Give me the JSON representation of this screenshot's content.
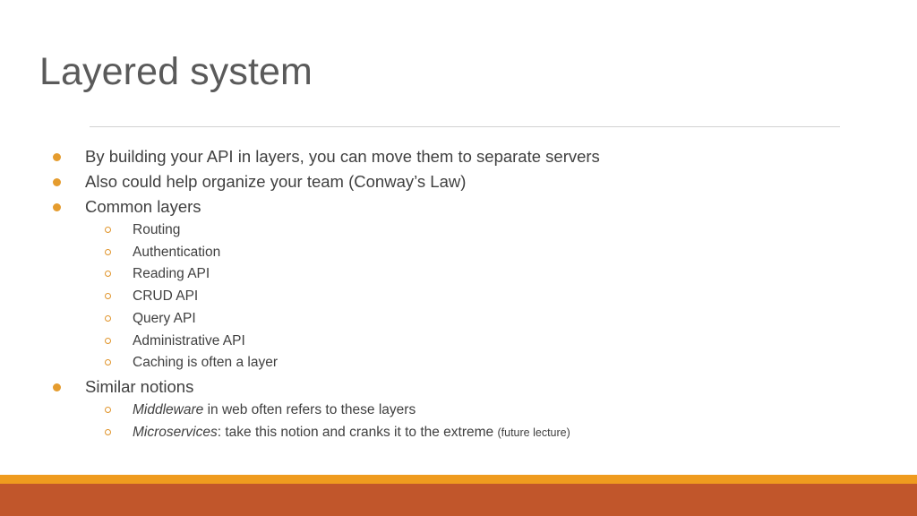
{
  "slide": {
    "title": "Layered system",
    "colors": {
      "title_text": "#5a5a5a",
      "body_text": "#404040",
      "bullet_level1": "#e59c2e",
      "bullet_level2": "#e0942a",
      "divider": "#d2d2d2",
      "footer_strip": "#ef9b1e",
      "footer_band": "#c1562b",
      "background": "#ffffff"
    },
    "bullets": [
      {
        "text": "By building your API in layers, you can move them to separate servers",
        "children": []
      },
      {
        "text": "Also could help organize your team (Conway’s Law)",
        "children": []
      },
      {
        "text": "Common layers",
        "children": [
          {
            "text": "Routing"
          },
          {
            "text": "Authentication"
          },
          {
            "text": "Reading API"
          },
          {
            "text": "CRUD API"
          },
          {
            "text": "Query API"
          },
          {
            "text": "Administrative API"
          },
          {
            "text": "Caching is often a layer"
          }
        ]
      },
      {
        "text": "Similar notions",
        "children": [
          {
            "italic_lead": "Middleware",
            "text": " in web often refers to these layers"
          },
          {
            "italic_lead": "Microservices",
            "text": ": take this notion and cranks it to the extreme ",
            "small_tail": "(future lecture)"
          }
        ]
      }
    ]
  }
}
